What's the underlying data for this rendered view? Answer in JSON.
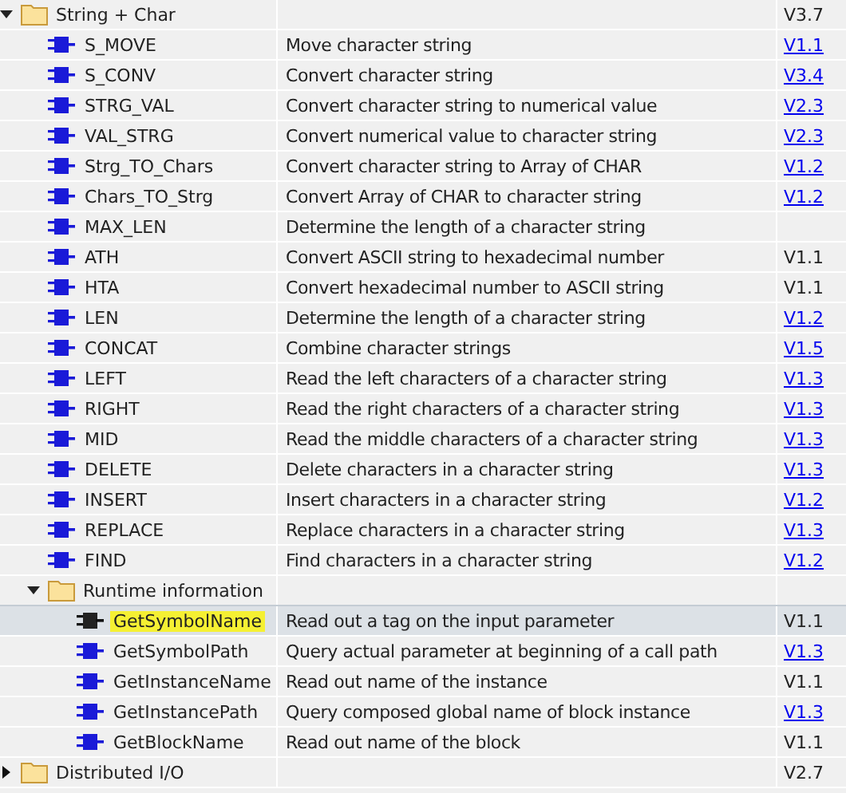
{
  "tree": [
    {
      "kind": "folder",
      "name": "String + Char",
      "version": "V3.7",
      "link": false,
      "expanded": true,
      "selected": false,
      "highlighted": false,
      "children": [
        {
          "kind": "block",
          "name": "S_MOVE",
          "description": "Move character string",
          "version": "V1.1",
          "link": true,
          "selected": false,
          "highlighted": false
        },
        {
          "kind": "block",
          "name": "S_CONV",
          "description": "Convert character string",
          "version": "V3.4",
          "link": true,
          "selected": false,
          "highlighted": false
        },
        {
          "kind": "block",
          "name": "STRG_VAL",
          "description": "Convert character string to numerical value",
          "version": "V2.3",
          "link": true,
          "selected": false,
          "highlighted": false
        },
        {
          "kind": "block",
          "name": "VAL_STRG",
          "description": "Convert numerical value to character string",
          "version": "V2.3",
          "link": true,
          "selected": false,
          "highlighted": false
        },
        {
          "kind": "block",
          "name": "Strg_TO_Chars",
          "description": "Convert character string to Array of CHAR",
          "version": "V1.2",
          "link": true,
          "selected": false,
          "highlighted": false
        },
        {
          "kind": "block",
          "name": "Chars_TO_Strg",
          "description": "Convert Array of CHAR to character string",
          "version": "V1.2",
          "link": true,
          "selected": false,
          "highlighted": false
        },
        {
          "kind": "block",
          "name": "MAX_LEN",
          "description": "Determine the length of a character string",
          "selected": false,
          "highlighted": false
        },
        {
          "kind": "block",
          "name": "ATH",
          "description": "Convert ASCII string to hexadecimal number",
          "version": "V1.1",
          "link": false,
          "selected": false,
          "highlighted": false
        },
        {
          "kind": "block",
          "name": "HTA",
          "description": "Convert hexadecimal number to ASCII string",
          "version": "V1.1",
          "link": false,
          "selected": false,
          "highlighted": false
        },
        {
          "kind": "block",
          "name": "LEN",
          "description": "Determine the length of a character string",
          "version": "V1.2",
          "link": true,
          "selected": false,
          "highlighted": false
        },
        {
          "kind": "block",
          "name": "CONCAT",
          "description": "Combine character strings",
          "version": "V1.5",
          "link": true,
          "selected": false,
          "highlighted": false
        },
        {
          "kind": "block",
          "name": "LEFT",
          "description": "Read the left characters of a character string",
          "version": "V1.3",
          "link": true,
          "selected": false,
          "highlighted": false
        },
        {
          "kind": "block",
          "name": "RIGHT",
          "description": "Read the right characters of a character string",
          "version": "V1.3",
          "link": true,
          "selected": false,
          "highlighted": false
        },
        {
          "kind": "block",
          "name": "MID",
          "description": "Read the middle characters of a character string",
          "version": "V1.3",
          "link": true,
          "selected": false,
          "highlighted": false
        },
        {
          "kind": "block",
          "name": "DELETE",
          "description": "Delete characters in a character string",
          "version": "V1.3",
          "link": true,
          "selected": false,
          "highlighted": false
        },
        {
          "kind": "block",
          "name": "INSERT",
          "description": "Insert characters in a character string",
          "version": "V1.2",
          "link": true,
          "selected": false,
          "highlighted": false
        },
        {
          "kind": "block",
          "name": "REPLACE",
          "description": "Replace characters in a character string",
          "version": "V1.3",
          "link": true,
          "selected": false,
          "highlighted": false
        },
        {
          "kind": "block",
          "name": "FIND",
          "description": "Find characters in a character string",
          "version": "V1.2",
          "link": true,
          "selected": false,
          "highlighted": false
        },
        {
          "kind": "folder",
          "name": "Runtime information",
          "expanded": true,
          "selected": false,
          "highlighted": false,
          "children": [
            {
              "kind": "block",
              "name": "GetSymbolName",
              "description": "Read out a tag on the input parameter",
              "version": "V1.1",
              "link": false,
              "selected": true,
              "highlighted": true
            },
            {
              "kind": "block",
              "name": "GetSymbolPath",
              "description": "Query actual parameter at beginning of a call path",
              "version": "V1.3",
              "link": true,
              "selected": false,
              "highlighted": false
            },
            {
              "kind": "block",
              "name": "GetInstanceName",
              "description": "Read out name of the instance",
              "version": "V1.1",
              "link": false,
              "selected": false,
              "highlighted": false
            },
            {
              "kind": "block",
              "name": "GetInstancePath",
              "description": "Query composed global name of block instance",
              "version": "V1.3",
              "link": true,
              "selected": false,
              "highlighted": false
            },
            {
              "kind": "block",
              "name": "GetBlockName",
              "description": "Read out name of the block",
              "version": "V1.1",
              "link": false,
              "selected": false,
              "highlighted": false
            }
          ]
        }
      ]
    },
    {
      "kind": "folder",
      "name": "Distributed I/O",
      "version": "V2.7",
      "link": false,
      "expanded": false,
      "selected": false,
      "highlighted": false
    }
  ]
}
